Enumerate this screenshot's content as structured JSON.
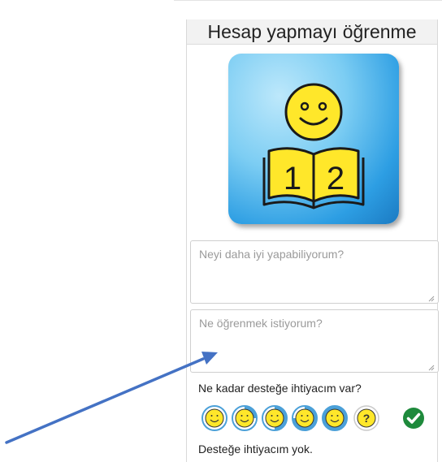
{
  "card": {
    "title": "Hesap yapmayı öğrenme",
    "illustration_icon": "smiley-reading-book-icon",
    "book_digits": [
      "1",
      "2"
    ]
  },
  "fields": {
    "strength_placeholder": "Neyi daha iyi yapabiliyorum?",
    "strength_value": "",
    "learning_placeholder": "Ne öğrenmek istiyorum?",
    "learning_value": ""
  },
  "support": {
    "question": "Ne kadar desteğe ihtiyacım var?",
    "options": [
      {
        "icon": "smiley-face-icon",
        "level": 0
      },
      {
        "icon": "smiley-face-icon",
        "level": 0.25
      },
      {
        "icon": "smiley-face-icon",
        "level": 0.5
      },
      {
        "icon": "smiley-face-icon",
        "level": 0.75
      },
      {
        "icon": "smiley-face-icon",
        "level": 1
      }
    ],
    "unknown_option": {
      "icon": "question-mark-icon",
      "label": "?"
    },
    "selected_icon": "check-circle-icon",
    "status_text": "Desteğe ihtiyacım yok."
  },
  "colors": {
    "face_yellow": "#ffe72a",
    "ring_blue": "#4ba0d8",
    "check_green": "#1e8a3c",
    "arrow_blue": "#4472c4"
  }
}
